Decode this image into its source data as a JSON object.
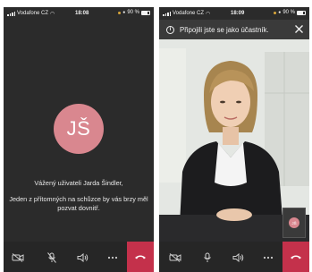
{
  "left_screen": {
    "status_bar": {
      "carrier": "Vodafone CZ",
      "time": "18:08",
      "battery": "90 %"
    },
    "avatar_initials": "JŠ",
    "greeting": "Vážený uživateli Jarda Šindler,",
    "message": "Jeden z přítomných na schůzce by vás brzy měl pozvat dovnitř."
  },
  "right_screen": {
    "status_bar": {
      "carrier": "Vodafone CZ",
      "time": "18:09",
      "battery": "90 %"
    },
    "banner_text": "Připojili jste se jako účastník.",
    "self_view_initials": "JŠ"
  },
  "icons": {
    "toolbar": [
      "video-off-icon",
      "mic-off-icon",
      "speaker-icon",
      "more-icon",
      "hangup-icon"
    ],
    "banner": [
      "info-icon",
      "close-icon"
    ]
  },
  "colors": {
    "phone_background": "#2b2b2b",
    "avatar": "#d9878f",
    "hangup": "#c4314b",
    "banner": "#3a3a3a"
  }
}
